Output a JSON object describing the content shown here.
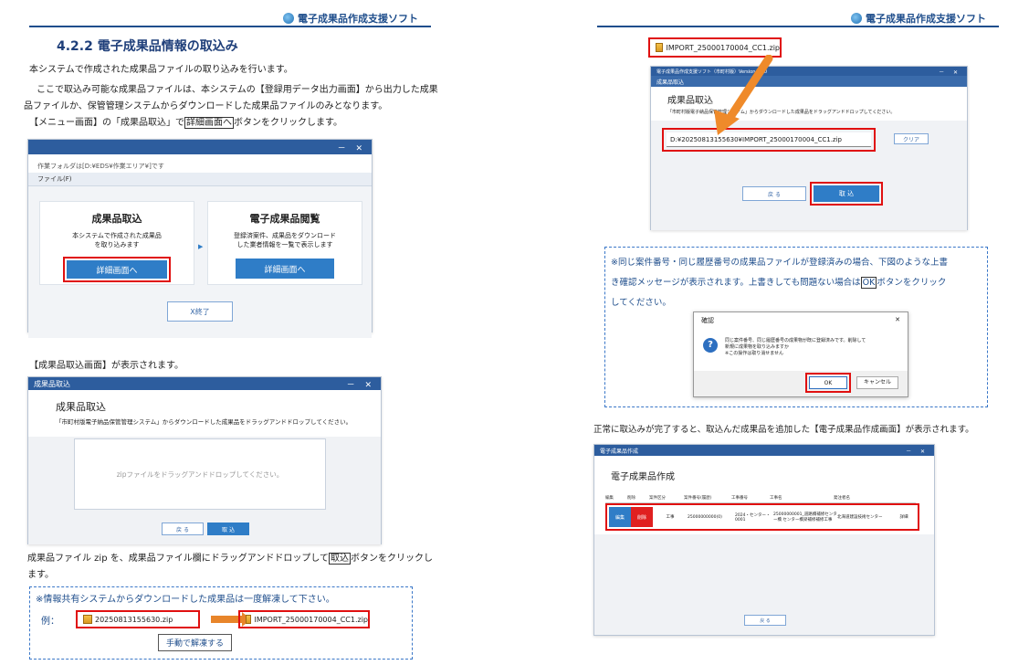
{
  "header": {
    "brand": "電子成果品作成支援ソフト"
  },
  "left": {
    "section_title": "4.2.2 電子成果品情報の取込み",
    "p1": "本システムで作成された成果品ファイルの取り込みを行います。",
    "p2a": "ここで取込み可能な成果品ファイルは、本システムの【登録用データ出力画面】から出力した成果",
    "p2b": "品ファイルか、保管管理システムからダウンロードした成果品ファイルのみとなります。",
    "p3_pre": "【メニュー画面】の「成果品取込」で",
    "p3_btn": "詳細画面へ",
    "p3_post": "ボタンをクリックします。",
    "menu_win": {
      "path": "作業フォルダは[D:¥EDS¥作業エリア¥]です",
      "menu": "ファイル(F)",
      "card1_title": "成果品取込",
      "card1_desc1": "本システムで作成された成果品",
      "card1_desc2": "を取り込みます",
      "card1_btn": "詳細画面へ",
      "card2_title": "電子成果品閲覧",
      "card2_desc1": "登録済案件、成果品をダウンロード",
      "card2_desc2": "した業者情報を一覧で表示します",
      "card2_btn": "詳細画面へ",
      "exit_btn": "X終了",
      "arrow": "▶",
      "win_ctl": "－ ✕"
    },
    "p4": "【成果品取込画面】が表示されます。",
    "import_win": {
      "title": "成果品取込",
      "heading": "成果品取込",
      "desc": "「市町村版電子納品保管管理システム」からダウンロードした成果品をドラッグアンドドロップしてください。",
      "drop_text": "zipファイルをドラッグアンドドロップしてください。",
      "back_btn": "戻 る",
      "import_btn": "取 込",
      "win_ctl": "－ ✕"
    },
    "p5_pre": "成果品ファイル zip を、成果品ファイル欄にドラッグアンドドロップして",
    "p5_btn": "取込",
    "p5_post": "ボタンをクリックし",
    "p5b": "ます。",
    "note": {
      "text": "※情報共有システムからダウンロードした成果品は一度解凍して下さい。",
      "example_label": "例：",
      "zip_before": "20250813155630.zip",
      "zip_after": "IMPORT_25000170004_CC1.zip",
      "manual": "手動で解凍する"
    }
  },
  "right": {
    "zip_file": "IMPORT_25000170004_CC1.zip",
    "import_win": {
      "title_bar": "電子成果品作成支援ソフト（市町村版）Version 3.00",
      "tab": "成果品取込",
      "heading": "成果品取込",
      "desc": "「市町村版電子納品保管管理システム」からダウンロードした成果品をドラッグアンドドロップしてください。",
      "path": "D:¥20250813155630¥IMPORT_25000170004_CC1.zip",
      "clear_btn": "クリア",
      "back_btn": "戻 る",
      "import_btn": "取 込",
      "win_ctl": "－ ✕"
    },
    "note": {
      "line1": "※同じ案件番号・同じ履歴番号の成果品ファイルが登録済みの場合、下図のような上書",
      "line2_pre": "き確認メッセージが表示されます。上書きしても問題ない場合は",
      "line2_btn": "OK",
      "line2_post": "ボタンをクリック",
      "line3": "してください。",
      "dialog": {
        "title": "確認",
        "close": "✕",
        "icon": "?",
        "msg1": "同じ案件番号、同じ履歴番号の成果物が既に登録済みです。削除して",
        "msg2": "新規に成果物を取り込みますか",
        "msg3": "※この操作は取り消せません",
        "ok": "OK",
        "cancel": "キャンセル"
      }
    },
    "p_done": "正常に取込みが完了すると、取込んだ成果品を追加した【電子成果品作成画面】が表示されます。",
    "create_win": {
      "title": "電子成果品作成",
      "heading": "電子成果品作成",
      "win_ctl": "－ ✕",
      "columns": [
        "編集",
        "削除",
        "案件区分",
        "案件番号(履歴)",
        "工事番号",
        "工事名",
        "発注者名",
        ""
      ],
      "row": [
        "編集",
        "削除",
        "工事",
        "25000000000(0)",
        "2024・センター・0001",
        "25000000001_道路橋補修センター橋 センター橋梁補修補修工事",
        "北海道建設技術センター",
        "詳細"
      ],
      "back_btn": "戻 る"
    }
  }
}
